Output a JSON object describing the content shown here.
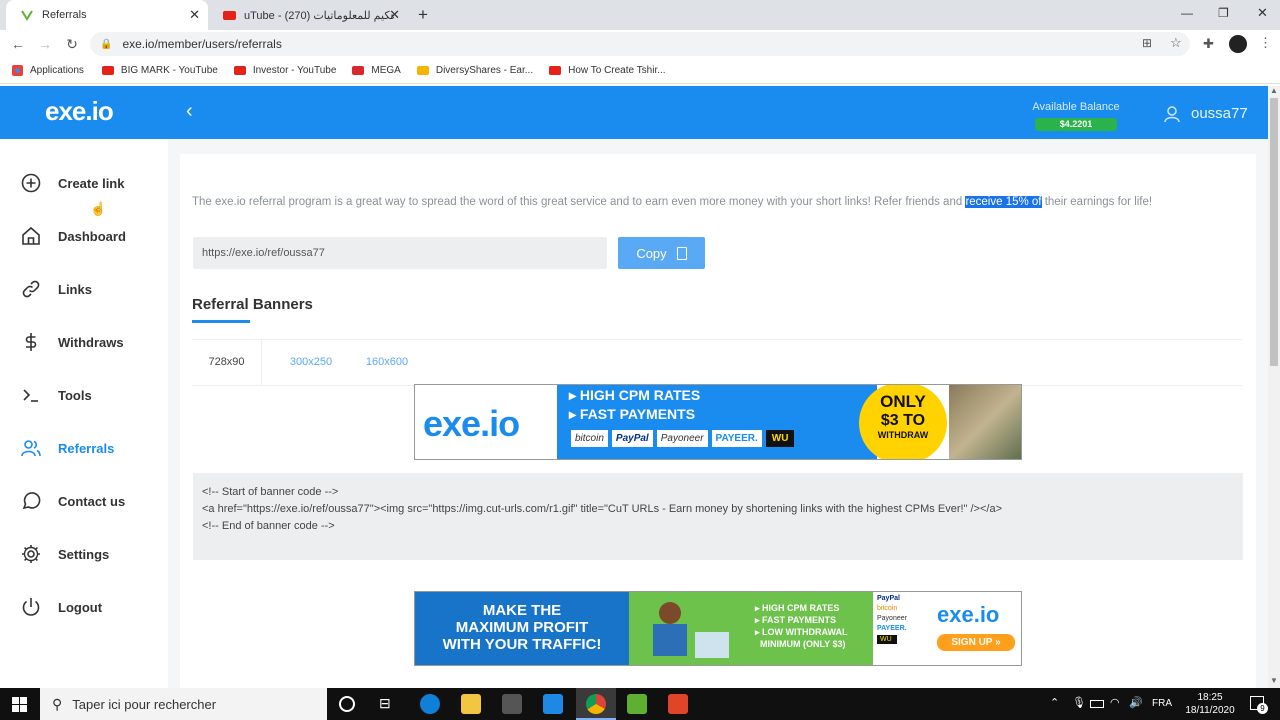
{
  "browser": {
    "tabs": [
      {
        "title": "Referrals",
        "active": true
      },
      {
        "title": "uTube - حكيم للمعلوماتيات (270)",
        "active": false
      }
    ],
    "new_tab": "+",
    "window_controls": {
      "minimize": "—",
      "maximize": "❐",
      "close": "✕"
    },
    "url": "exe.io/member/users/referrals",
    "bookmarks": [
      {
        "label": "Applications",
        "color": "#4285f4"
      },
      {
        "label": "BIG MARK - YouTube",
        "color": "#e62117"
      },
      {
        "label": "Investor - YouTube",
        "color": "#e62117"
      },
      {
        "label": "MEGA",
        "color": "#d9272e"
      },
      {
        "label": "DiversyShares - Ear...",
        "color": "#f4b400"
      },
      {
        "label": "How To Create Tshir...",
        "color": "#e62117"
      }
    ]
  },
  "header": {
    "logo": "exe.io",
    "balance_label": "Available Balance",
    "balance_value": "$4.2201",
    "username": "oussa77"
  },
  "sidebar": {
    "items": [
      {
        "label": "Create link",
        "icon": "plus-circle-icon"
      },
      {
        "label": "Dashboard",
        "icon": "home-icon"
      },
      {
        "label": "Links",
        "icon": "link-icon"
      },
      {
        "label": "Withdraws",
        "icon": "dollar-icon"
      },
      {
        "label": "Tools",
        "icon": "terminal-icon"
      },
      {
        "label": "Referrals",
        "icon": "users-icon",
        "active": true
      },
      {
        "label": "Contact us",
        "icon": "chat-icon"
      },
      {
        "label": "Settings",
        "icon": "gear-icon"
      },
      {
        "label": "Logout",
        "icon": "power-icon"
      }
    ]
  },
  "main": {
    "intro_before": "The exe.io referral program is a great way to spread the word of this great service and to earn even more money with your short links! Refer friends and ",
    "intro_highlight": "receive 15% of",
    "intro_after": " their earnings for life!",
    "ref_link": "https://exe.io/ref/oussa77",
    "copy_label": "Copy",
    "section_title": "Referral Banners",
    "tabs": [
      "728x90",
      "300x250",
      "160x600"
    ],
    "banner1": {
      "logo": "exe.io",
      "line1": "HIGH CPM RATES",
      "line2": "FAST PAYMENTS",
      "payments": [
        "bitcoin",
        "PayPal",
        "Payoneer",
        "PAYEER.",
        "WU"
      ],
      "badge_top": "ONLY",
      "badge_mid": "$3 TO",
      "badge_bottom": "WITHDRAW"
    },
    "code_lines": [
      "<!-- Start of banner code -->",
      "<a href=\"https://exe.io/ref/oussa77\"><img src=\"https://img.cut-urls.com/r1.gif\" title=\"CuT URLs - Earn money by shortening links with the highest CPMs Ever!\" /></a>",
      "<!-- End of banner code -->"
    ],
    "banner2": {
      "headline1": "MAKE THE",
      "headline2": "MAXIMUM PROFIT",
      "headline3": "WITH YOUR TRAFFIC!",
      "bullet1": "HIGH CPM RATES",
      "bullet2": "FAST PAYMENTS",
      "bullet3": "LOW WITHDRAWAL",
      "bullet4": "MINIMUM (ONLY $3)",
      "logo": "exe.io",
      "signup": "SIGN UP »"
    }
  },
  "taskbar": {
    "search_placeholder": "Taper ici pour rechercher",
    "lang": "FRA",
    "time": "18:25",
    "date": "18/11/2020",
    "notif_count": "9"
  },
  "colors": {
    "brand": "#1a8cf0",
    "balance_badge": "#29b34a",
    "highlight": "#1a73e8"
  }
}
